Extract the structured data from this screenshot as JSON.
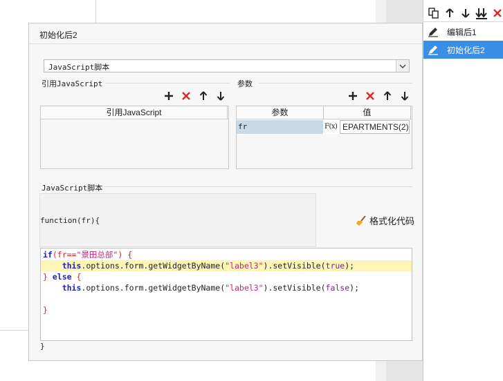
{
  "dialog": {
    "title": "初始化后2",
    "script_type": "JavaScript脚本",
    "ref_section_label": "引用JavaScript",
    "ref_column": "引用JavaScript",
    "params_section_label": "参数",
    "params_columns": [
      "参数",
      "值"
    ],
    "params_rows": [
      {
        "name": "fr",
        "fx": "F(x)",
        "value": "EPARTMENTS(2)"
      }
    ],
    "script_section_label": "JavaScript脚本",
    "function_header": "function(fr){",
    "format_label": "格式化代码",
    "closing_brace": "}"
  },
  "code_text": {
    "l1_if": "if",
    "l1_open": "(fr==",
    "l1_str": "\"景田总部\"",
    "l1_close": ") {",
    "l2_this": "this",
    "l2_mid": ".options.form.getWidgetByName(",
    "l2_str": "\"label3\"",
    "l2_mid2": ").setVisible(",
    "l2_bool": "true",
    "l2_end": ");",
    "l3_brace": "}",
    "l3_else": "else",
    "l3_open": "{",
    "l4_this": "this",
    "l4_mid": ".options.form.getWidgetByName(",
    "l4_str": "\"label3\"",
    "l4_mid2": ").setVisible(",
    "l4_bool": "false",
    "l4_end": ");",
    "l6_brace": "}"
  },
  "right_panel": {
    "items": [
      {
        "label": "编辑后1",
        "selected": false
      },
      {
        "label": "初始化后2",
        "selected": true
      }
    ]
  },
  "colors": {
    "selection": "#3a8ee6",
    "add": "#222222",
    "delete": "#e0271e",
    "param_cell": "#c8d9e8",
    "highlight_line": "#fbf6b8"
  },
  "icons": [
    "copy-icon",
    "arrow-up-icon",
    "arrow-down-icon",
    "move-bottom-icon",
    "delete-icon",
    "pencil-icon",
    "add-icon",
    "broom-icon",
    "chevron-down-icon"
  ]
}
